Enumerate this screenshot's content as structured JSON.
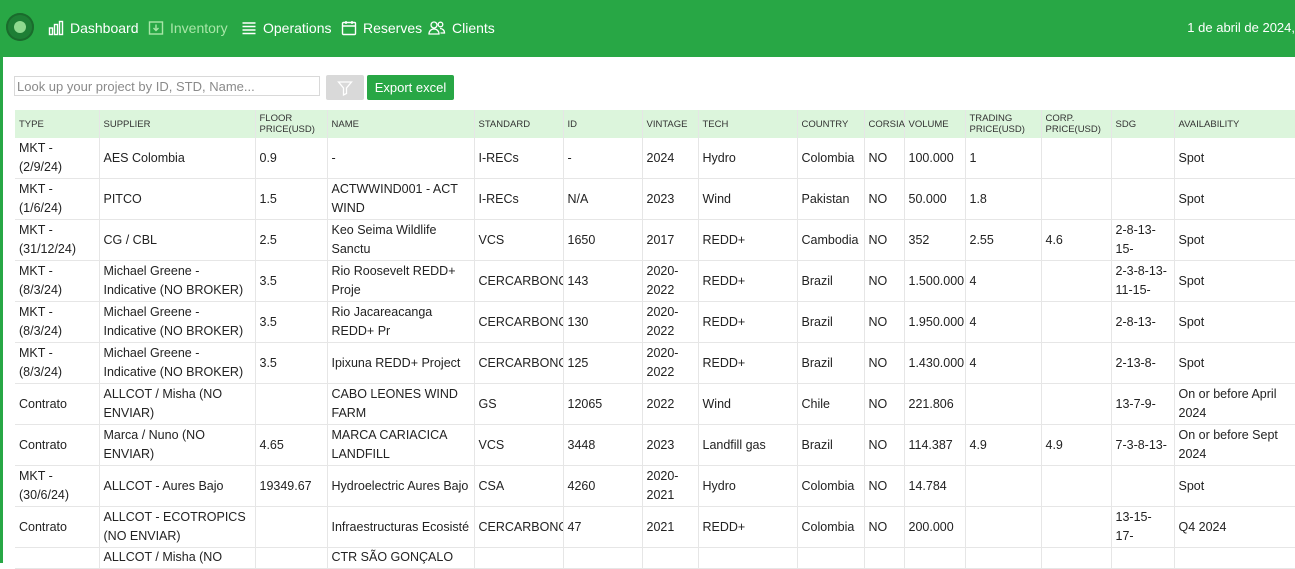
{
  "nav": {
    "items": [
      {
        "label": "Dashboard",
        "icon": "bar-chart-icon"
      },
      {
        "label": "Inventory",
        "icon": "inventory-tray-icon"
      },
      {
        "label": "Operations",
        "icon": "list-icon"
      },
      {
        "label": "Reserves",
        "icon": "calendar-icon"
      },
      {
        "label": "Clients",
        "icon": "users-icon"
      }
    ],
    "active": "Inventory",
    "date": "1 de abril de 2024,"
  },
  "toolbar": {
    "search_placeholder": "Look up your project by ID, STD, Name...",
    "search_value": "",
    "filter_icon": "filter-icon",
    "export_label": "Export excel"
  },
  "colors": {
    "brand": "#28a745",
    "header_bg": "#dcf5dc",
    "active_nav": "#a8e6a8"
  },
  "table": {
    "headers": [
      "TYPE",
      "SUPPLIER",
      "FLOOR PRICE(USD)",
      "NAME",
      "STANDARD",
      "ID",
      "VINTAGE",
      "TECH",
      "COUNTRY",
      "CORSIA",
      "VOLUME",
      "TRADING PRICE(USD)",
      "CORP. PRICE(USD)",
      "SDG",
      "AVAILABILITY"
    ],
    "rows": [
      [
        "MKT - (2/9/24)",
        "AES Colombia",
        "0.9",
        "-",
        "I-RECs",
        "-",
        "2024",
        "Hydro",
        "Colombia",
        "NO",
        "100.000",
        "1",
        "",
        "",
        "Spot"
      ],
      [
        "MKT - (1/6/24)",
        "PITCO",
        "1.5",
        "ACTWWIND001 - ACT WIND",
        "I-RECs",
        "N/A",
        "2023",
        "Wind",
        "Pakistan",
        "NO",
        "50.000",
        "1.8",
        "",
        "",
        "Spot"
      ],
      [
        "MKT - (31/12/24)",
        "CG / CBL",
        "2.5",
        "Keo Seima Wildlife Sanctu",
        "VCS",
        "1650",
        "2017",
        "REDD+",
        "Cambodia",
        "NO",
        "352",
        "2.55",
        "4.6",
        "2-8-13-15-",
        "Spot"
      ],
      [
        "MKT - (8/3/24)",
        "Michael Greene - Indicative (NO BROKER)",
        "3.5",
        "Rio Roosevelt REDD+ Proje",
        "CERCARBONO",
        "143",
        "2020-2022",
        "REDD+",
        "Brazil",
        "NO",
        "1.500.000",
        "4",
        "",
        "2-3-8-13-11-15-",
        "Spot"
      ],
      [
        "MKT - (8/3/24)",
        "Michael Greene - Indicative (NO BROKER)",
        "3.5",
        "Rio Jacareacanga REDD+ Pr",
        "CERCARBONO",
        "130",
        "2020-2022",
        "REDD+",
        "Brazil",
        "NO",
        "1.950.000",
        "4",
        "",
        "2-8-13-",
        "Spot"
      ],
      [
        "MKT - (8/3/24)",
        "Michael Greene - Indicative (NO BROKER)",
        "3.5",
        "Ipixuna REDD+ Project",
        "CERCARBONO",
        "125",
        "2020-2022",
        "REDD+",
        "Brazil",
        "NO",
        "1.430.000",
        "4",
        "",
        "2-13-8-",
        "Spot"
      ],
      [
        "Contrato",
        "ALLCOT / Misha (NO ENVIAR)",
        "",
        "CABO LEONES WIND FARM",
        "GS",
        "12065",
        "2022",
        "Wind",
        "Chile",
        "NO",
        "221.806",
        "",
        "",
        "13-7-9-",
        "On or before April 2024"
      ],
      [
        "Contrato",
        "Marca / Nuno (NO ENVIAR)",
        "4.65",
        "MARCA CARIACICA LANDFILL",
        "VCS",
        "3448",
        "2023",
        "Landfill gas",
        "Brazil",
        "NO",
        "114.387",
        "4.9",
        "4.9",
        "7-3-8-13-",
        "On or before Sept 2024"
      ],
      [
        "MKT - (30/6/24)",
        "ALLCOT - Aures Bajo",
        "19349.67",
        "Hydroelectric Aures Bajo",
        "CSA",
        "4260",
        "2020-2021",
        "Hydro",
        "Colombia",
        "NO",
        "14.784",
        "",
        "",
        "",
        "Spot"
      ],
      [
        "Contrato",
        "ALLCOT - ECOTROPICS (NO ENVIAR)",
        "",
        "Infraestructuras Ecosisté",
        "CERCARBONO",
        "47",
        "2021",
        "REDD+",
        "Colombia",
        "NO",
        "200.000",
        "",
        "",
        "13-15-17-",
        "Q4 2024"
      ],
      [
        "",
        "ALLCOT / Misha (NO",
        "",
        "CTR SÃO GONÇALO",
        "",
        "",
        "",
        "",
        "",
        "",
        "",
        "",
        "",
        "",
        ""
      ]
    ]
  }
}
